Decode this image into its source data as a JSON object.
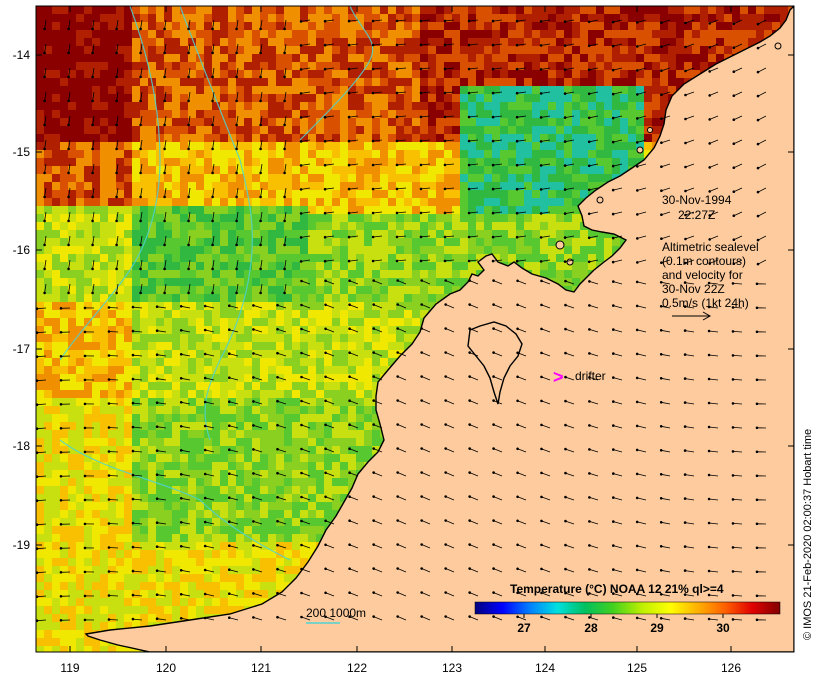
{
  "map": {
    "x_ticks": [
      "119",
      "120",
      "121",
      "122",
      "123",
      "124",
      "125",
      "126"
    ],
    "y_ticks": [
      "-14",
      "-15",
      "-16",
      "-17",
      "-18",
      "-19"
    ],
    "colors": {
      "land": "#fdcb9d",
      "coast": "#000000",
      "contour": "#4fd3d3",
      "drifter": "#ff00ff"
    }
  },
  "annotations": {
    "date": "30-Nov-1994",
    "time": "22:27Z",
    "legend_line1": "Altimetric sealevel",
    "legend_line2": "(0.1m contours)",
    "legend_line3": "and velocity for",
    "legend_line4": "30-Nov 22Z",
    "legend_line5": "0.5m/s (1kt 24h)",
    "drifter_symbol": ">",
    "drifter_label": "drifter",
    "depth_label": "200  1000m"
  },
  "colorbar": {
    "title": "Temperature (°C) NOAA 12 21% ql>=4",
    "ticks": [
      "27",
      "28",
      "29",
      "30"
    ],
    "colors": [
      "#00007f",
      "#0000ff",
      "#0080ff",
      "#00e0e0",
      "#00c060",
      "#40d020",
      "#c0f000",
      "#ffff00",
      "#ffb000",
      "#ff6000",
      "#e00000",
      "#800000"
    ]
  },
  "credit": "© IMOS 21-Feb-2020 02:00:37 Hobart time"
}
